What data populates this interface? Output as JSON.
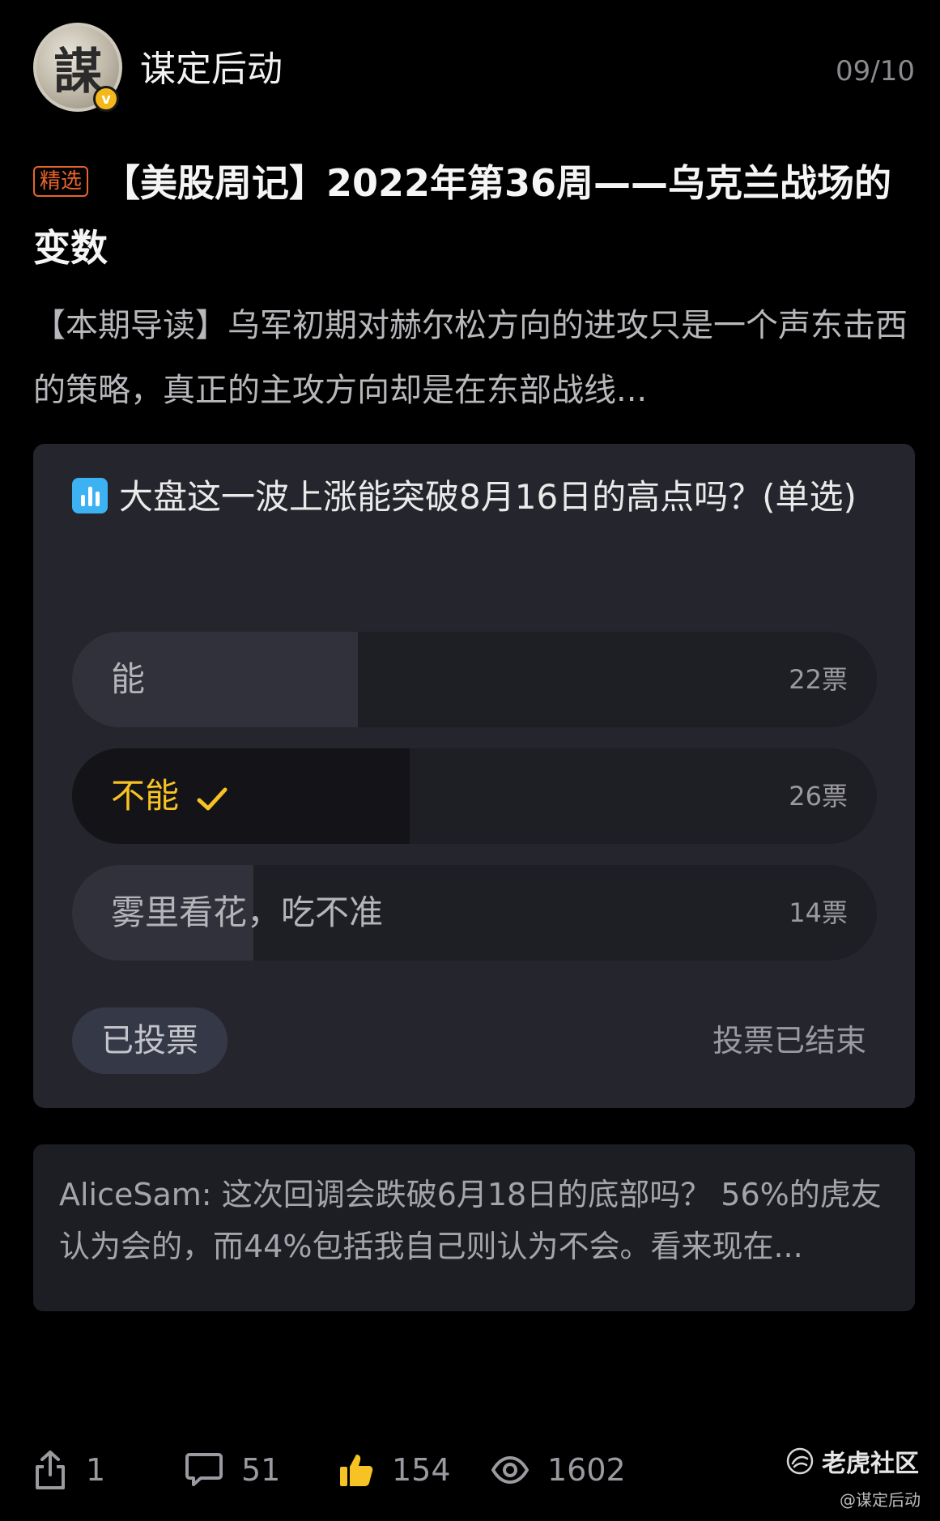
{
  "header": {
    "avatar_char": "謀",
    "verified_mark": "v",
    "username": "谋定后动",
    "page_indicator": "09/10"
  },
  "post": {
    "tag": "精选",
    "title": "【美股周记】2022年第36周——乌克兰战场的变数",
    "summary": "【本期导读】乌军初期对赫尔松方向的进攻只是一个声东击西的策略，真正的主攻方向却是在东部战线..."
  },
  "poll": {
    "icon": "bar-chart-icon",
    "question": "大盘这一波上涨能突破8月16日的高点吗？(单选)",
    "options": [
      {
        "label": "能",
        "votes_label": "22票",
        "votes": 22,
        "selected": false
      },
      {
        "label": "不能",
        "votes_label": "26票",
        "votes": 26,
        "selected": true
      },
      {
        "label": "雾里看花，吃不准",
        "votes_label": "14票",
        "votes": 14,
        "selected": false
      }
    ],
    "voted_label": "已投票",
    "status_label": "投票已结束",
    "colors": {
      "selected_text": "#f6c224",
      "icon_bg": "#3db2f2"
    }
  },
  "comment": {
    "text": "AliceSam: 这次回调会跌破6月18日的底部吗？  56%的虎友认为会的，而44%包括我自己则认为不会。看来现在..."
  },
  "footer": {
    "share_count": "1",
    "comment_count": "51",
    "like_count": "154",
    "view_count": "1602",
    "brand_name": "老虎社区",
    "brand_user": "@谋定后动"
  }
}
